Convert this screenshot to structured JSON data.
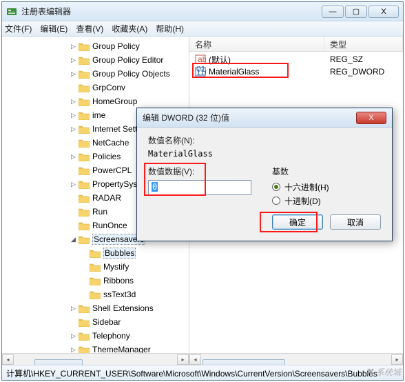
{
  "window": {
    "title": "注册表编辑器",
    "buttons": {
      "min": "—",
      "max": "▢",
      "close": "X"
    }
  },
  "menu": {
    "file": "文件(F)",
    "edit": "编辑(E)",
    "view": "查看(V)",
    "favorites": "收藏夹(A)",
    "help": "帮助(H)"
  },
  "tree": [
    {
      "depth": 3,
      "exp": "▷",
      "label": "Group Policy"
    },
    {
      "depth": 3,
      "exp": "▷",
      "label": "Group Policy Editor"
    },
    {
      "depth": 3,
      "exp": "▷",
      "label": "Group Policy Objects"
    },
    {
      "depth": 3,
      "exp": "",
      "label": "GrpConv"
    },
    {
      "depth": 3,
      "exp": "▷",
      "label": "HomeGroup"
    },
    {
      "depth": 3,
      "exp": "▷",
      "label": "ime"
    },
    {
      "depth": 3,
      "exp": "▷",
      "label": "Internet Settings"
    },
    {
      "depth": 3,
      "exp": "",
      "label": "NetCache"
    },
    {
      "depth": 3,
      "exp": "▷",
      "label": "Policies"
    },
    {
      "depth": 3,
      "exp": "",
      "label": "PowerCPL"
    },
    {
      "depth": 3,
      "exp": "▷",
      "label": "PropertySystem"
    },
    {
      "depth": 3,
      "exp": "",
      "label": "RADAR"
    },
    {
      "depth": 3,
      "exp": "",
      "label": "Run"
    },
    {
      "depth": 3,
      "exp": "",
      "label": "RunOnce"
    },
    {
      "depth": 3,
      "exp": "◢",
      "label": "Screensavers",
      "selected": true
    },
    {
      "depth": 4,
      "exp": "",
      "label": "Bubbles",
      "selected": true
    },
    {
      "depth": 4,
      "exp": "",
      "label": "Mystify"
    },
    {
      "depth": 4,
      "exp": "",
      "label": "Ribbons"
    },
    {
      "depth": 4,
      "exp": "",
      "label": "ssText3d"
    },
    {
      "depth": 3,
      "exp": "▷",
      "label": "Shell Extensions"
    },
    {
      "depth": 3,
      "exp": "",
      "label": "Sidebar"
    },
    {
      "depth": 3,
      "exp": "▷",
      "label": "Telephony"
    },
    {
      "depth": 3,
      "exp": "▷",
      "label": "ThemeManager"
    }
  ],
  "list": {
    "columns": {
      "name": "名称",
      "type": "类型"
    },
    "rows": [
      {
        "icon": "string-value-icon",
        "name": "(默认)",
        "type": "REG_SZ"
      },
      {
        "icon": "dword-value-icon",
        "name": "MaterialGlass",
        "type": "REG_DWORD"
      }
    ]
  },
  "statusbar": "计算机\\HKEY_CURRENT_USER\\Software\\Microsoft\\Windows\\CurrentVersion\\Screensavers\\Bubbles",
  "dialog": {
    "title": "编辑 DWORD (32 位)值",
    "name_label": "数值名称(N):",
    "name_value": "MaterialGlass",
    "data_label": "数值数据(V):",
    "data_value": "0",
    "base_label": "基数",
    "radix_hex": "十六进制(H)",
    "radix_dec": "十进制(D)",
    "ok": "确定",
    "cancel": "取消"
  },
  "watermark": "系统城"
}
